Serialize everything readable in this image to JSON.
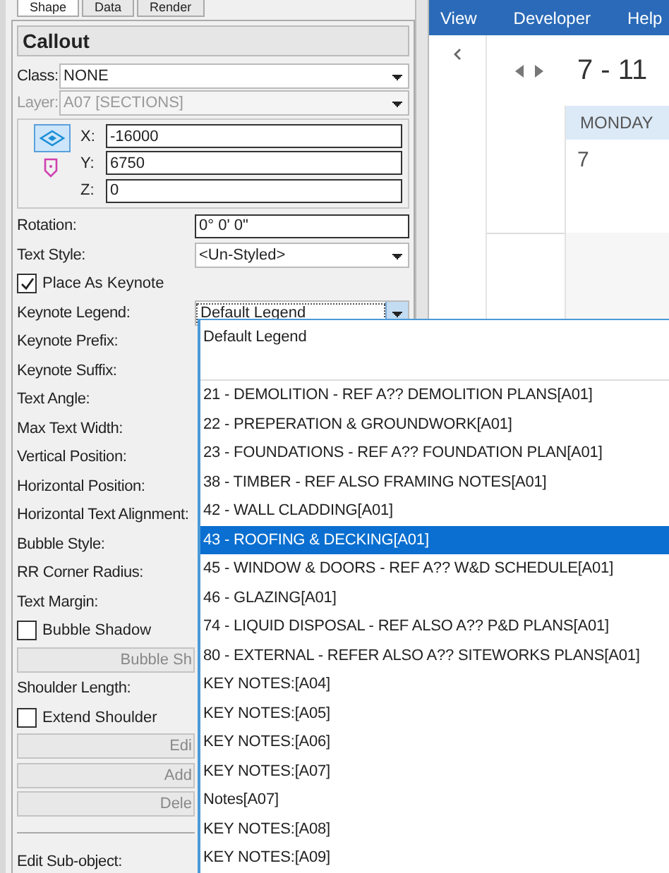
{
  "tabs": [
    {
      "label": "Shape",
      "selected": true
    },
    {
      "label": "Data",
      "selected": false
    },
    {
      "label": "Render",
      "selected": false
    }
  ],
  "panel_title": "Callout",
  "class_field": {
    "label": "Class:",
    "value": "NONE",
    "disabled": false
  },
  "layer_field": {
    "label": "Layer:",
    "value": "A07 [SECTIONS]",
    "disabled": true
  },
  "coordinates": [
    {
      "label": "X:",
      "value": "-16000"
    },
    {
      "label": "Y:",
      "value": "6750"
    },
    {
      "label": "Z:",
      "value": "0"
    }
  ],
  "properties": [
    {
      "kind": "field",
      "label": "Rotation:",
      "value": "0° 0' 0\""
    },
    {
      "kind": "dropdown",
      "label": "Text Style:",
      "value": "<Un-Styled>",
      "open": false
    },
    {
      "kind": "checkbox",
      "label": "Place As Keynote",
      "checked": true
    },
    {
      "kind": "dropdown",
      "label": "Keynote Legend:",
      "value": "Default Legend",
      "open": true
    },
    {
      "kind": "label",
      "label": "Keynote Prefix:"
    },
    {
      "kind": "label",
      "label": "Keynote Suffix:"
    },
    {
      "kind": "label",
      "label": "Text Angle:"
    },
    {
      "kind": "label",
      "label": "Max Text Width:"
    },
    {
      "kind": "label",
      "label": "Vertical Position:"
    },
    {
      "kind": "label",
      "label": "Horizontal Position:"
    },
    {
      "kind": "label",
      "label": "Horizontal Text Alignment:"
    },
    {
      "kind": "label",
      "label": "Bubble Style:"
    },
    {
      "kind": "label",
      "label": "RR Corner Radius:"
    },
    {
      "kind": "label",
      "label": "Text Margin:"
    },
    {
      "kind": "checkbox",
      "label": "Bubble Shadow",
      "checked": false
    },
    {
      "kind": "button",
      "label": "Bubble Sh"
    },
    {
      "kind": "label",
      "label": "Shoulder Length:"
    },
    {
      "kind": "checkbox",
      "label": "Extend Shoulder",
      "checked": false
    },
    {
      "kind": "button",
      "label": "Edi"
    },
    {
      "kind": "button",
      "label": "Add"
    },
    {
      "kind": "button",
      "label": "Dele"
    },
    {
      "kind": "separator"
    },
    {
      "kind": "label",
      "label": "Edit Sub-object:"
    }
  ],
  "dropdown_list": [
    {
      "kind": "entry",
      "label": "Default Legend",
      "selected": false
    },
    {
      "kind": "blank"
    },
    {
      "kind": "entry",
      "label": "21 - DEMOLITION - REF A?? DEMOLITION PLANS[A01]",
      "selected": false
    },
    {
      "kind": "entry",
      "label": "22 - PREPERATION & GROUNDWORK[A01]",
      "selected": false
    },
    {
      "kind": "entry",
      "label": "23 - FOUNDATIONS - REF A?? FOUNDATION PLAN[A01]",
      "selected": false
    },
    {
      "kind": "entry",
      "label": "38 - TIMBER - REF ALSO FRAMING NOTES[A01]",
      "selected": false
    },
    {
      "kind": "entry",
      "label": "42 - WALL CLADDING[A01]",
      "selected": false
    },
    {
      "kind": "entry",
      "label": "43 - ROOFING & DECKING[A01]",
      "selected": true
    },
    {
      "kind": "entry",
      "label": "45 - WINDOW & DOORS - REF A?? W&D SCHEDULE[A01]",
      "selected": false
    },
    {
      "kind": "entry",
      "label": "46 - GLAZING[A01]",
      "selected": false
    },
    {
      "kind": "entry",
      "label": "74 - LIQUID DISPOSAL - REF ALSO A?? P&D PLANS[A01]",
      "selected": false
    },
    {
      "kind": "entry",
      "label": "80 - EXTERNAL - REFER ALSO A?? SITEWORKS PLANS[A01]",
      "selected": false
    },
    {
      "kind": "entry",
      "label": "KEY NOTES:[A04]",
      "selected": false
    },
    {
      "kind": "entry",
      "label": "KEY NOTES:[A05]",
      "selected": false
    },
    {
      "kind": "entry",
      "label": "KEY NOTES:[A06]",
      "selected": false
    },
    {
      "kind": "entry",
      "label": "KEY NOTES:[A07]",
      "selected": false
    },
    {
      "kind": "entry",
      "label": "Notes[A07]",
      "selected": false
    },
    {
      "kind": "entry",
      "label": "KEY NOTES:[A08]",
      "selected": false
    },
    {
      "kind": "entry",
      "label": "KEY NOTES:[A09]",
      "selected": false
    }
  ],
  "calendar": {
    "menu": [
      "View",
      "Developer",
      "Help"
    ],
    "date_range": "7 - 11",
    "day_header": "MONDAY",
    "day_number": "7"
  }
}
